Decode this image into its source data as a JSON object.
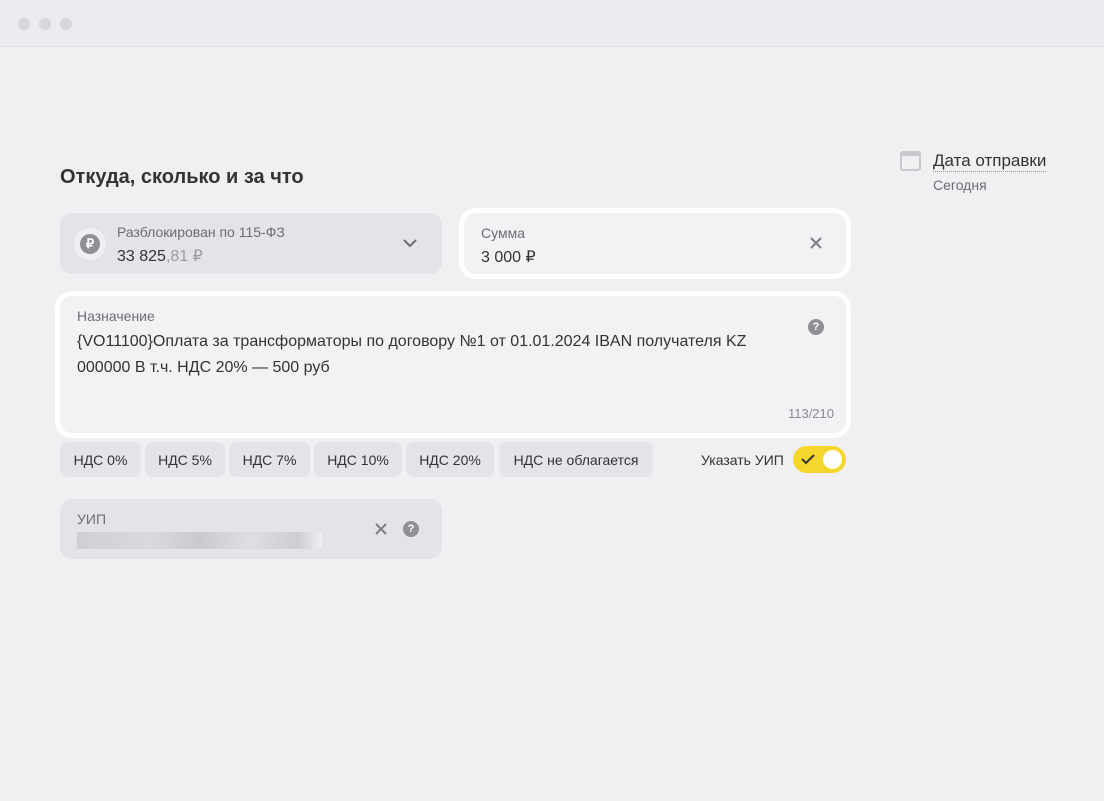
{
  "section_title": "Откуда, сколько и за что",
  "account": {
    "label": "Разблокирован по 115-ФЗ",
    "amount_int": "33 825",
    "amount_frac": ",81 ₽"
  },
  "sum": {
    "label": "Сумма",
    "value": "3 000 ₽"
  },
  "purpose": {
    "label": "Назначение",
    "value": "{VO11100}Оплата за трансформаторы по договору №1 от 01.01.2024 IBAN получателя KZ 000000 В т.ч. НДС 20% — 500 руб",
    "counter": "113/210"
  },
  "vat_chips": [
    "НДС 0%",
    "НДС 5%",
    "НДС 7%",
    "НДС 10%",
    "НДС 20%",
    "НДС не облагается"
  ],
  "uip_toggle": {
    "label": "Указать УИП",
    "on": true,
    "color": "#f5d62a"
  },
  "uip": {
    "label": "УИП"
  },
  "date": {
    "title": "Дата отправки",
    "value": "Сегодня"
  }
}
